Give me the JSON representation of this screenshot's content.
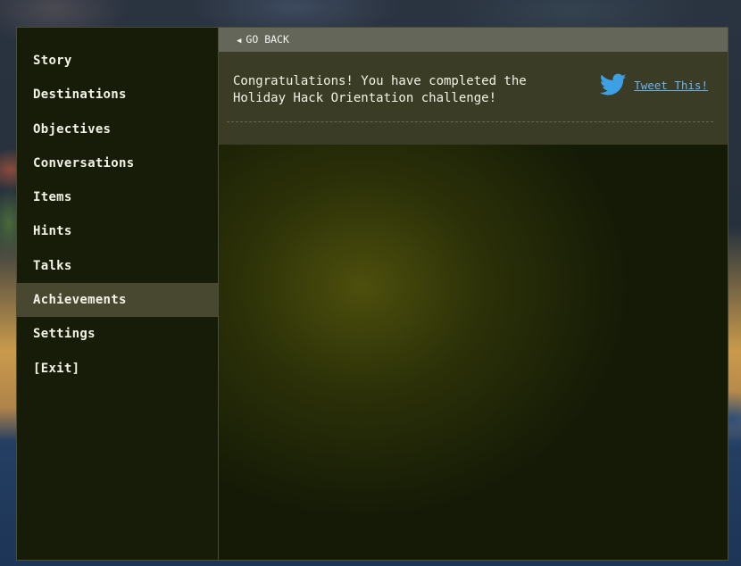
{
  "sidebar": {
    "items": [
      {
        "label": "Story"
      },
      {
        "label": "Destinations"
      },
      {
        "label": "Objectives"
      },
      {
        "label": "Conversations"
      },
      {
        "label": "Items"
      },
      {
        "label": "Hints"
      },
      {
        "label": "Talks"
      },
      {
        "label": "Achievements",
        "active": true
      },
      {
        "label": "Settings"
      },
      {
        "label": "[Exit]"
      }
    ]
  },
  "content": {
    "back_label": "GO BACK",
    "back_icon": "left-triangle-icon",
    "achievements": [
      {
        "text": "Congratulations! You have completed the Holiday Hack Orientation challenge!",
        "tweet_label": "Tweet This!",
        "tweet_icon": "twitter-bird-icon"
      }
    ]
  },
  "colors": {
    "sidebar_bg": "#171c08",
    "active_item_bg": "#47482f",
    "back_bar_bg": "#65665a",
    "achievement_bg": "#3a3c25",
    "link": "#6cb4f0",
    "text": "#f2f2e6",
    "twitter_blue": "#3ea0e4"
  }
}
